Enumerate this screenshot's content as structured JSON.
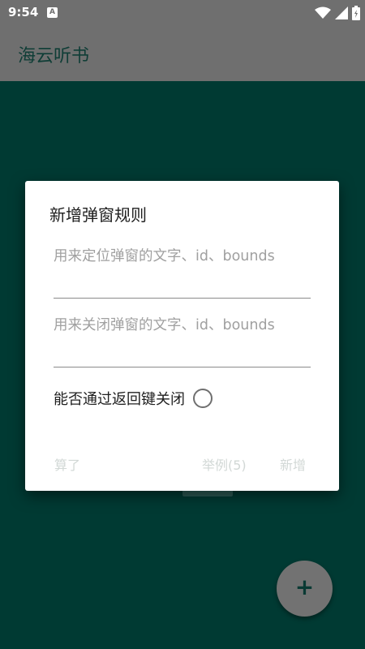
{
  "statusbar": {
    "time": "9:54",
    "notification_badge": "A",
    "icons": [
      "wifi-icon",
      "signal-icon",
      "battery-icon"
    ]
  },
  "appbar": {
    "title": "海云听书"
  },
  "dialog": {
    "title": "新增弹窗规则",
    "locate_field": {
      "value": "",
      "placeholder": "用来定位弹窗的文字、id、bounds"
    },
    "close_field": {
      "value": "",
      "placeholder": "用来关闭弹窗的文字、id、bounds"
    },
    "back_key_label": "能否通过返回键关闭",
    "buttons": {
      "cancel": "算了",
      "example": "举例(5)",
      "add": "新增"
    }
  },
  "fab": {
    "label": "+"
  },
  "colors": {
    "background": "#003a33",
    "appbar": "#6f6f6f",
    "dialog": "#ffffff",
    "fab": "#727272"
  }
}
